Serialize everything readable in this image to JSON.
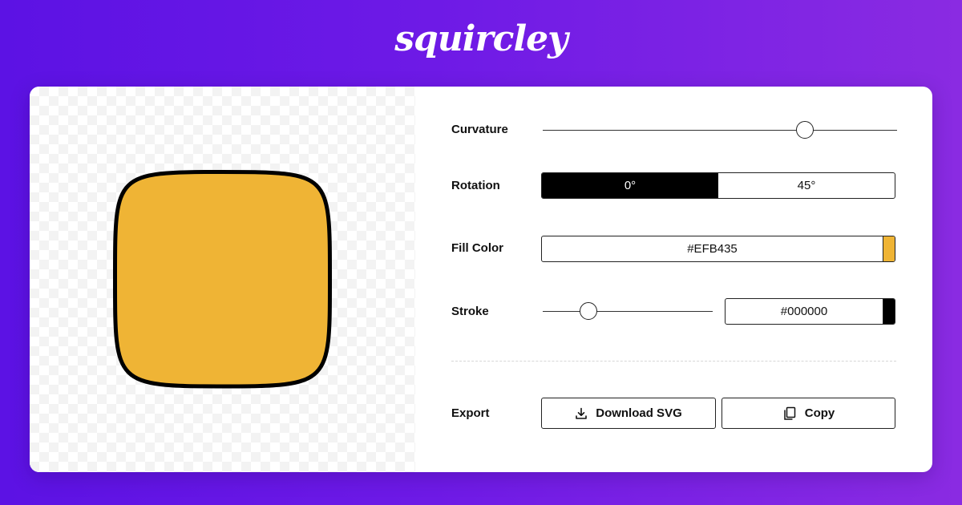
{
  "app": {
    "logo": "squircley"
  },
  "preview": {
    "fill_color": "#EFB435",
    "stroke_color": "#000000"
  },
  "controls": {
    "curvature": {
      "label": "Curvature",
      "value": 0.74
    },
    "rotation": {
      "label": "Rotation",
      "options": [
        "0°",
        "45°"
      ],
      "selected": "0°"
    },
    "fill": {
      "label": "Fill Color",
      "value": "#EFB435",
      "swatch": "#EFB435"
    },
    "stroke": {
      "label": "Stroke",
      "width_value": 0.27,
      "color": "#000000",
      "swatch": "#000000"
    },
    "export": {
      "label": "Export",
      "download_label": "Download SVG",
      "copy_label": "Copy",
      "download_icon": "download-icon",
      "copy_icon": "copy-icon"
    }
  },
  "colors": {
    "accent_start": "#5c12e4",
    "accent_end": "#8a2be2"
  }
}
